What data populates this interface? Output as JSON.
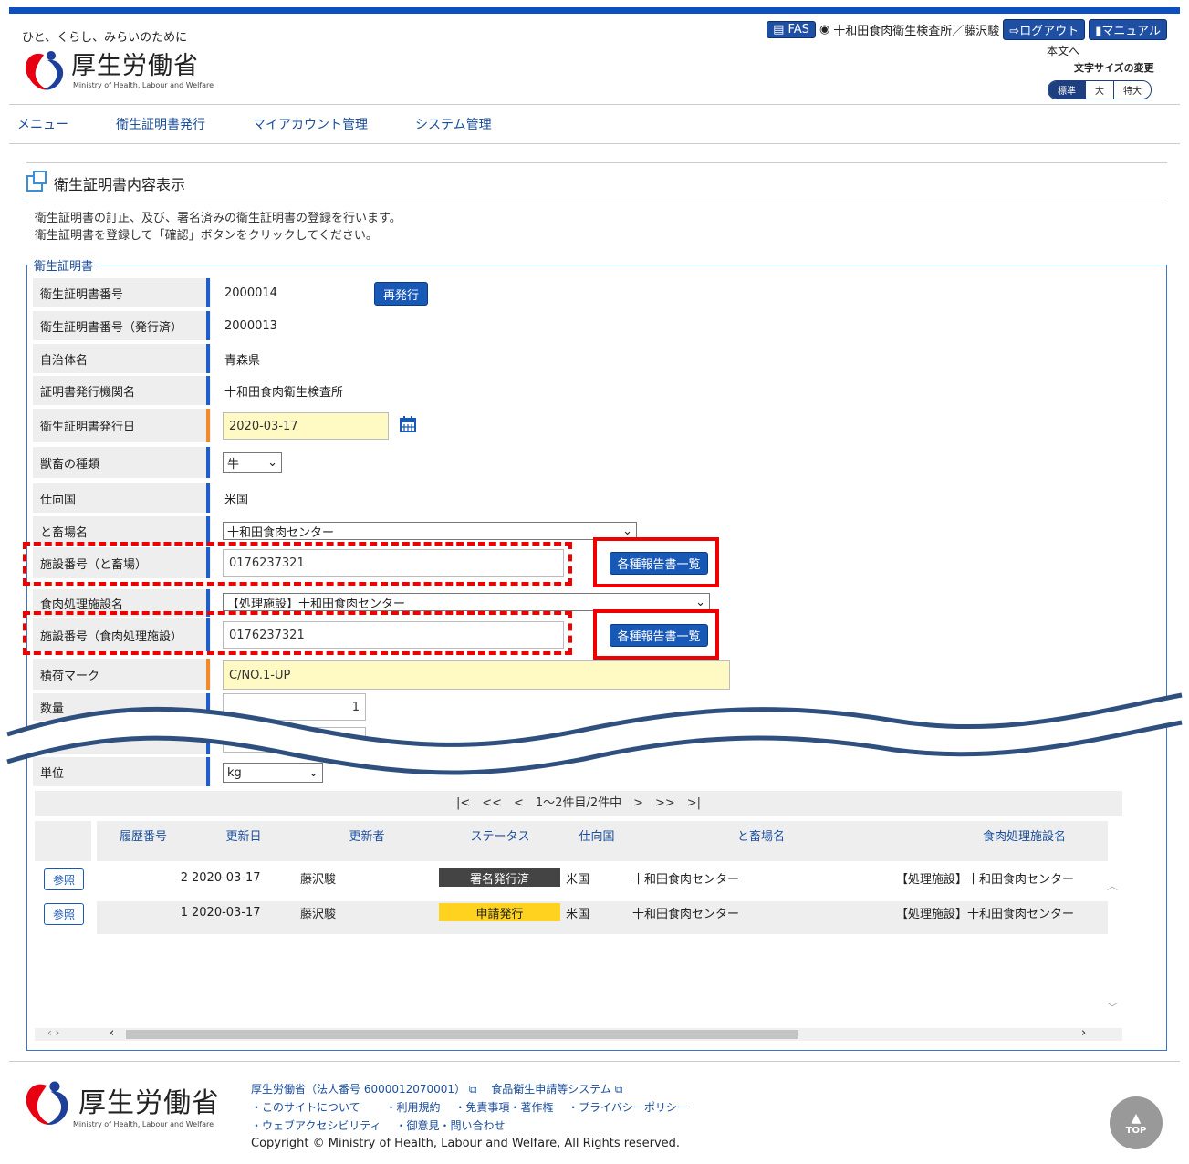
{
  "header": {
    "tagline": "ひと、くらし、みらいのために",
    "logo_name": "厚生労働省",
    "logo_sub": "Ministry of Health, Labour and Welfare",
    "fas_label": "FAS",
    "user_label": "十和田食肉衛生検査所／藤沢駿",
    "logout_label": "ログアウト",
    "manual_label": "マニュアル",
    "honbun_label": "本文へ",
    "fontsize_label": "文字サイズの変更",
    "fontsize_options": [
      "標準",
      "大",
      "特大"
    ]
  },
  "nav": {
    "items": [
      "メニュー",
      "衛生証明書発行",
      "マイアカウント管理",
      "システム管理"
    ]
  },
  "page": {
    "title": "衛生証明書内容表示",
    "desc1": "衛生証明書の訂正、及び、署名済みの衛生証明書の登録を行います。",
    "desc2": "衛生証明書を登録して「確認」ボタンをクリックしてください。",
    "legend": "衛生証明書"
  },
  "form": {
    "cert_no_label": "衛生証明書番号",
    "cert_no": "2000014",
    "reissue_label": "再発行",
    "cert_no_issued_label": "衛生証明書番号（発行済）",
    "cert_no_issued": "2000013",
    "municipality_label": "自治体名",
    "municipality": "青森県",
    "issuer_label": "証明書発行機関名",
    "issuer": "十和田食肉衛生検査所",
    "issue_date_label": "衛生証明書発行日",
    "issue_date": "2020-03-17",
    "animal_label": "獣畜の種類",
    "animal": "牛",
    "destination_label": "仕向国",
    "destination": "米国",
    "slaughterhouse_label": "と畜場名",
    "slaughterhouse": "十和田食肉センター",
    "facility_no_label": "施設番号（と畜場）",
    "facility_no": "0176237321",
    "reports_label": "各種報告書一覧",
    "meat_facility_label": "食肉処理施設名",
    "meat_facility": "【処理施設】十和田食肉センター",
    "meat_facility_no_label": "施設番号（食肉処理施設）",
    "meat_facility_no": "0176237321",
    "mark_label": "積荷マーク",
    "mark": "C/NO.1-UP",
    "quantity_label": "数量",
    "quantity": "1",
    "unit_label": "単位",
    "unit": "kg"
  },
  "history": {
    "pager": "|<　<<　<　1～2件目/2件中　>　>>　>|",
    "headers": [
      "履歴番号",
      "更新日",
      "更新者",
      "ステータス",
      "仕向国",
      "と畜場名",
      "食肉処理施設名"
    ],
    "ref_label": "参照",
    "rows": [
      {
        "no": "2",
        "date": "2020-03-17",
        "user": "藤沢駿",
        "status": "署名発行済",
        "country": "米国",
        "slaughter": "十和田食肉センター",
        "facility": "【処理施設】十和田食肉センター"
      },
      {
        "no": "1",
        "date": "2020-03-17",
        "user": "藤沢駿",
        "status": "申請発行",
        "country": "米国",
        "slaughter": "十和田食肉センター",
        "facility": "【処理施設】十和田食肉センター"
      }
    ],
    "status_colors": {
      "signed": "#444444",
      "applied": "#ffd21f"
    }
  },
  "footer": {
    "line1": "厚生労働省（法人番号 6000012070001）",
    "system": "食品衛生申請等システム",
    "links1": [
      "・このサイトについて",
      "・利用規約",
      "・免責事項・著作権",
      "・プライバシーポリシー"
    ],
    "links2": [
      "・ウェブアクセシビリティ",
      "・御意見・問い合わせ"
    ],
    "copyright": "Copyright © Ministry of Health, Labour and Welfare, All Rights reserved.",
    "top_label": "TOP"
  },
  "colors": {
    "accent": "#0d4fbf",
    "button": "#1858b7",
    "highlight": "#ff0000",
    "input_yellow": "#fff9c4"
  }
}
